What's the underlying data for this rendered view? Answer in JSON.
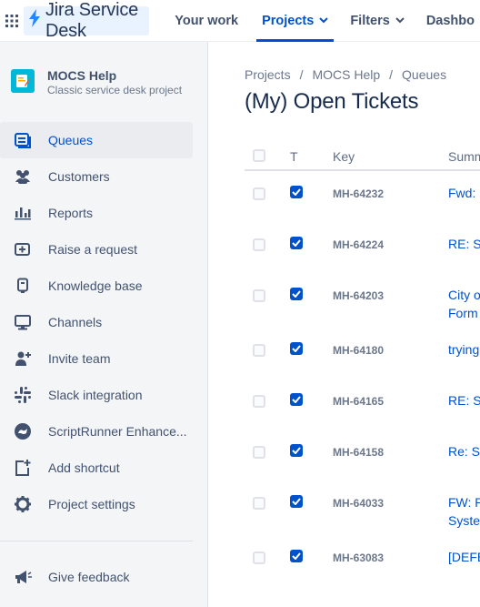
{
  "topbar": {
    "logo_text": "Jira Service Desk",
    "nav": [
      {
        "label": "Your work"
      },
      {
        "label": "Projects"
      },
      {
        "label": "Filters"
      },
      {
        "label": "Dashbo"
      }
    ]
  },
  "project": {
    "name": "MOCS Help",
    "type": "Classic service desk project"
  },
  "sidebar": {
    "items": [
      {
        "label": "Queues",
        "icon": "queues-icon",
        "active": true
      },
      {
        "label": "Customers",
        "icon": "customers-icon"
      },
      {
        "label": "Reports",
        "icon": "reports-icon"
      },
      {
        "label": "Raise a request",
        "icon": "raise-request-icon"
      },
      {
        "label": "Knowledge base",
        "icon": "knowledge-base-icon"
      },
      {
        "label": "Channels",
        "icon": "channels-icon"
      },
      {
        "label": "Invite team",
        "icon": "invite-team-icon"
      },
      {
        "label": "Slack integration",
        "icon": "slack-icon"
      },
      {
        "label": "ScriptRunner Enhance...",
        "icon": "scriptrunner-icon"
      },
      {
        "label": "Add shortcut",
        "icon": "add-shortcut-icon"
      },
      {
        "label": "Project settings",
        "icon": "gear-icon"
      }
    ],
    "feedback": "Give feedback"
  },
  "breadcrumb": [
    "Projects",
    "MOCS Help",
    "Queues"
  ],
  "page_title": "(My) Open Tickets",
  "table": {
    "headers": {
      "type": "T",
      "key": "Key",
      "summary": "Summ"
    },
    "rows": [
      {
        "key": "MH-64232",
        "summary": "Fwd: C",
        "summary2": ""
      },
      {
        "key": "MH-64224",
        "summary": "RE: Sc",
        "summary2": ""
      },
      {
        "key": "MH-64203",
        "summary": "City o",
        "summary2": "Form"
      },
      {
        "key": "MH-64180",
        "summary": "trying",
        "summary2": ""
      },
      {
        "key": "MH-64165",
        "summary": "RE: Sc",
        "summary2": ""
      },
      {
        "key": "MH-64158",
        "summary": "Re: Sc",
        "summary2": ""
      },
      {
        "key": "MH-64033",
        "summary": "FW: P.",
        "summary2": "Syster"
      },
      {
        "key": "MH-63083",
        "summary": "[DEFE",
        "summary2": ""
      }
    ]
  },
  "colors": {
    "accent": "#0052cc",
    "sidebar_bg": "#f4f5f7"
  }
}
